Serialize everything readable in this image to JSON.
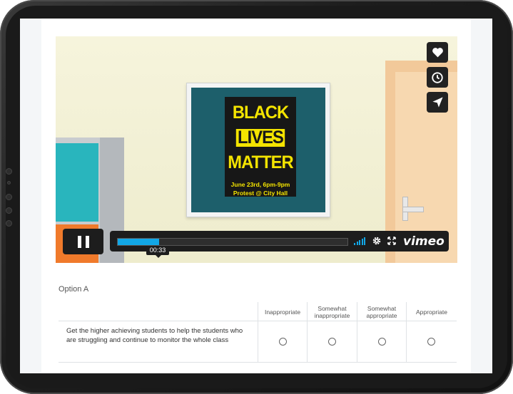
{
  "video": {
    "poster": {
      "line1": "BLACK",
      "line2": "LIVES",
      "line3": "MATTER",
      "event_line1": "June 23rd, 6pm-9pm",
      "event_line2": "Protest @ City Hall"
    },
    "side_buttons": [
      "heart-icon",
      "clock-icon",
      "send-icon"
    ],
    "timecode": "00:33",
    "progress": 0.18,
    "brand": "vimeo",
    "accent_color": "#12a7e6"
  },
  "question": {
    "option_label": "Option A",
    "columns": [
      "Inappropriate",
      "Somewhat inappropriate",
      "Somewhat appropriate",
      "Appropriate"
    ],
    "row_text": "Get the higher achieving students to help the students who are struggling and continue to monitor the whole class"
  }
}
